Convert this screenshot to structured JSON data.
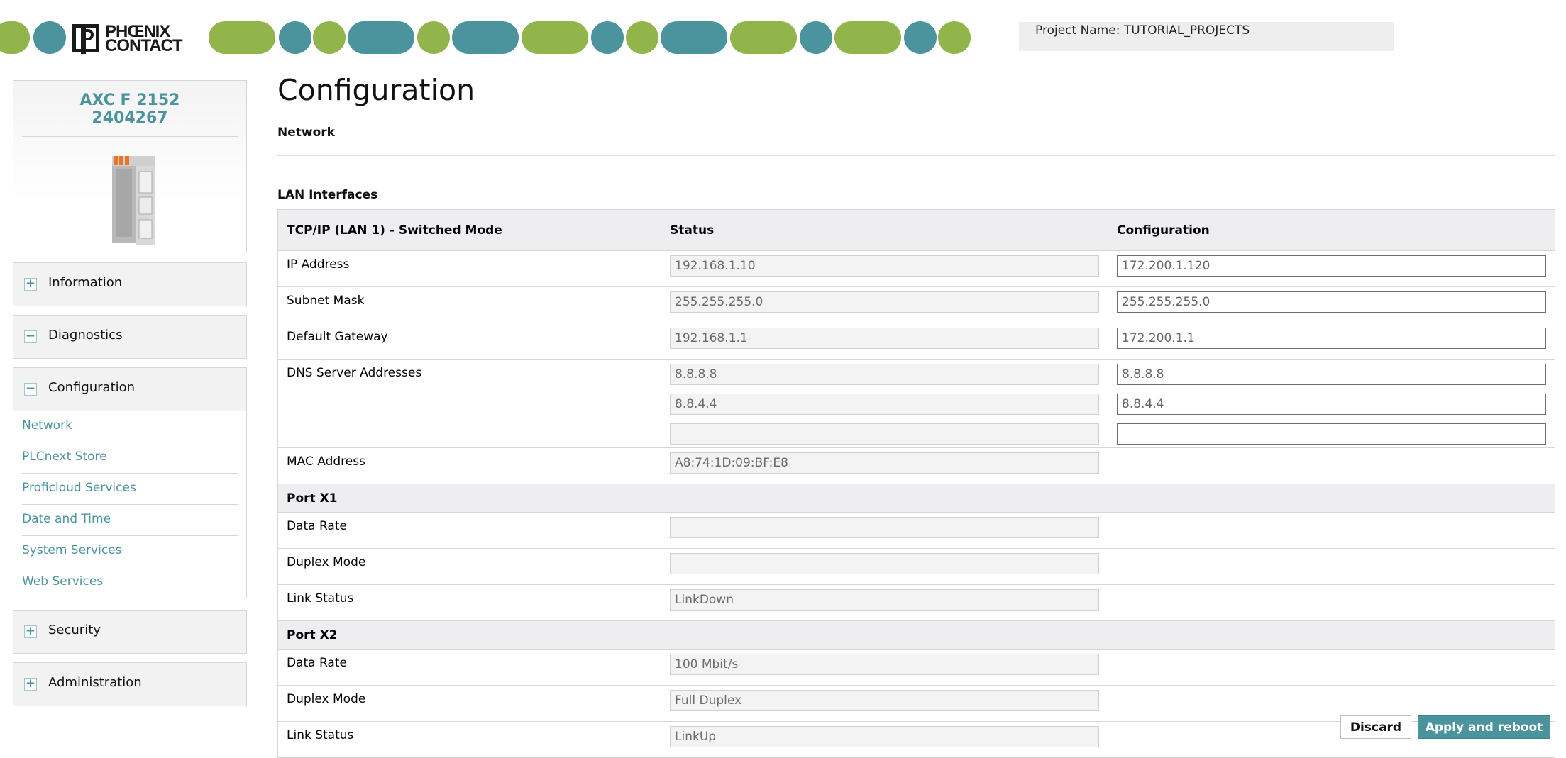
{
  "header": {
    "logo_text_line1": "PHŒNIX",
    "logo_text_line2": "CONTACT",
    "project_label": "Project Name: TUTORIAL_PROJECTS"
  },
  "sidebar": {
    "device_name": "AXC F 2152",
    "device_article": "2404267",
    "sections": [
      {
        "label": "Information",
        "state": "+"
      },
      {
        "label": "Diagnostics",
        "state": "−"
      },
      {
        "label": "Configuration",
        "state": "−",
        "items": [
          "Network",
          "PLCnext Store",
          "Proficloud Services",
          "Date and Time",
          "System Services",
          "Web Services"
        ]
      },
      {
        "label": "Security",
        "state": "+"
      },
      {
        "label": "Administration",
        "state": "+"
      }
    ]
  },
  "main": {
    "title": "Configuration",
    "subtitle": "Network",
    "lan_heading": "LAN Interfaces",
    "table": {
      "headers": [
        "TCP/IP (LAN 1) - Switched Mode",
        "Status",
        "Configuration"
      ],
      "ip": {
        "label": "IP Address",
        "status": "192.168.1.10",
        "config": "172.200.1.120"
      },
      "subnet": {
        "label": "Subnet Mask",
        "status": "255.255.255.0",
        "config": "255.255.255.0"
      },
      "gateway": {
        "label": "Default Gateway",
        "status": "192.168.1.1",
        "config": "172.200.1.1"
      },
      "dns": {
        "label": "DNS Server Addresses",
        "status": [
          "8.8.8.8",
          "8.8.4.4",
          ""
        ],
        "config": [
          "8.8.8.8",
          "8.8.4.4",
          ""
        ]
      },
      "mac": {
        "label": "MAC Address",
        "status": "A8:74:1D:09:BF:E8"
      },
      "port_x1": {
        "label": "Port X1",
        "data_rate": {
          "label": "Data Rate",
          "status": ""
        },
        "duplex": {
          "label": "Duplex Mode",
          "status": ""
        },
        "link": {
          "label": "Link Status",
          "status": "LinkDown"
        }
      },
      "port_x2": {
        "label": "Port X2",
        "data_rate": {
          "label": "Data Rate",
          "status": "100 Mbit/s"
        },
        "duplex": {
          "label": "Duplex Mode",
          "status": "Full Duplex"
        },
        "link": {
          "label": "Link Status",
          "status": "LinkUp"
        }
      }
    }
  },
  "actions": {
    "discard": "Discard",
    "apply": "Apply and reboot"
  },
  "colors": {
    "accent": "#4b939d",
    "green": "#92b54b",
    "header_bg": "#eeeef0"
  }
}
